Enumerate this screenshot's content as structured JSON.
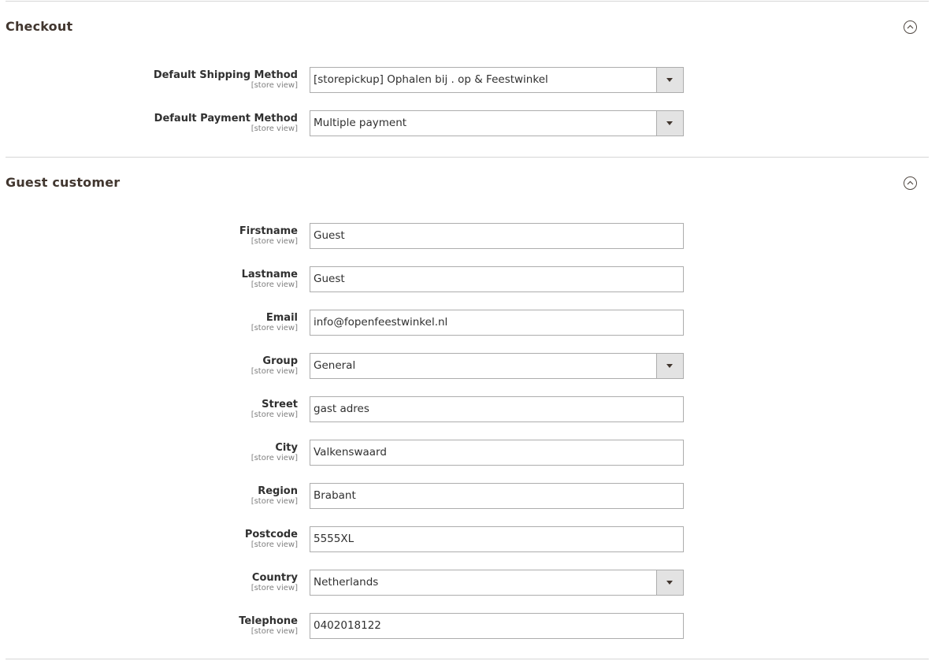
{
  "checkout": {
    "title": "Checkout",
    "collapse_icon": "chevron-up-circle-icon",
    "fields": {
      "shipping": {
        "label": "Default Shipping Method",
        "scope": "[store view]",
        "value": "[storepickup] Ophalen bij . op & Feestwinkel"
      },
      "payment": {
        "label": "Default Payment Method",
        "scope": "[store view]",
        "value": "Multiple payment"
      }
    }
  },
  "guest": {
    "title": "Guest customer",
    "collapse_icon": "chevron-up-circle-icon",
    "fields": {
      "firstname": {
        "label": "Firstname",
        "scope": "[store view]",
        "value": "Guest"
      },
      "lastname": {
        "label": "Lastname",
        "scope": "[store view]",
        "value": "Guest"
      },
      "email": {
        "label": "Email",
        "scope": "[store view]",
        "value": "info@fopenfeestwinkel.nl"
      },
      "group": {
        "label": "Group",
        "scope": "[store view]",
        "value": "General"
      },
      "street": {
        "label": "Street",
        "scope": "[store view]",
        "value": "gast adres"
      },
      "city": {
        "label": "City",
        "scope": "[store view]",
        "value": "Valkenswaard"
      },
      "region": {
        "label": "Region",
        "scope": "[store view]",
        "value": "Brabant"
      },
      "postcode": {
        "label": "Postcode",
        "scope": "[store view]",
        "value": "5555XL"
      },
      "country": {
        "label": "Country",
        "scope": "[store view]",
        "value": "Netherlands"
      },
      "telephone": {
        "label": "Telephone",
        "scope": "[store view]",
        "value": "0402018122"
      }
    }
  }
}
